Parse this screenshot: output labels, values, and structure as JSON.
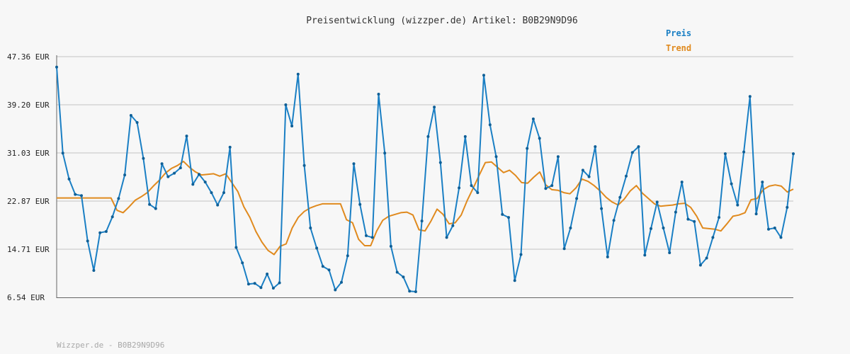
{
  "chart_data": {
    "type": "line",
    "title": "Preisentwicklung (wizzper.de) Artikel: B0B29N9D96",
    "footer": "Wizzper.de - B0B29N9D96",
    "y_tick_labels": [
      "47.36 EUR",
      "39.20 EUR",
      "31.03 EUR",
      "22.87 EUR",
      "14.71 EUR",
      "6.54 EUR"
    ],
    "y_ticks": [
      47.36,
      39.2,
      31.03,
      22.87,
      14.71,
      6.54
    ],
    "ylim": [
      6.54,
      47.36
    ],
    "grid": true,
    "legend_position": "top-right",
    "series": [
      {
        "name": "Preis",
        "color": "#1a7fc4",
        "values": [
          45.6,
          31.0,
          26.6,
          24.0,
          23.8,
          16.1,
          11.1,
          17.5,
          17.7,
          20.2,
          23.3,
          27.3,
          37.4,
          36.2,
          30.1,
          22.3,
          21.6,
          29.2,
          27.0,
          27.6,
          28.5,
          33.9,
          25.7,
          27.4,
          26.1,
          24.3,
          22.2,
          24.3,
          32.0,
          15.0,
          12.4,
          8.8,
          8.9,
          8.2,
          10.5,
          8.1,
          9.0,
          39.2,
          35.6,
          44.4,
          28.9,
          18.3,
          14.9,
          11.8,
          11.2,
          7.8,
          9.1,
          13.6,
          29.2,
          22.3,
          17.0,
          16.7,
          41.0,
          31.0,
          15.2,
          10.8,
          10.0,
          7.6,
          7.5,
          19.5,
          33.8,
          38.8,
          29.4,
          16.7,
          18.7,
          25.1,
          33.8,
          25.5,
          24.3,
          44.2,
          35.8,
          30.4,
          20.6,
          20.1,
          9.4,
          13.8,
          31.8,
          36.8,
          33.5,
          25.0,
          25.5,
          30.4,
          14.8,
          18.3,
          23.3,
          28.1,
          27.0,
          32.1,
          21.6,
          13.4,
          19.6,
          23.5,
          27.1,
          31.1,
          32.1,
          13.7,
          18.2,
          22.7,
          18.3,
          14.1,
          21.0,
          26.1,
          19.8,
          19.4,
          12.0,
          13.2,
          16.7,
          20.1,
          30.9,
          25.8,
          22.2,
          31.2,
          40.6,
          20.7,
          26.1,
          18.1,
          18.3,
          16.7,
          21.8,
          30.9
        ]
      },
      {
        "name": "Trend",
        "color": "#e08a1e",
        "values": [
          23.4,
          23.4,
          23.4,
          23.4,
          23.4,
          23.4,
          23.4,
          23.4,
          23.4,
          23.4,
          21.3,
          20.9,
          21.9,
          23.0,
          23.6,
          24.3,
          25.4,
          26.4,
          27.6,
          28.4,
          28.9,
          29.6,
          28.6,
          27.8,
          27.3,
          27.4,
          27.5,
          27.1,
          27.5,
          26.0,
          24.5,
          21.9,
          20.1,
          17.7,
          15.9,
          14.5,
          13.8,
          15.2,
          15.6,
          18.3,
          20.1,
          21.1,
          21.7,
          22.1,
          22.4,
          22.4,
          22.4,
          22.4,
          19.7,
          19.2,
          16.4,
          15.3,
          15.3,
          17.8,
          19.6,
          20.3,
          20.6,
          20.9,
          21.0,
          20.5,
          18.0,
          17.8,
          19.5,
          21.5,
          20.6,
          19.0,
          19.2,
          20.5,
          23.0,
          25.1,
          27.3,
          29.4,
          29.5,
          28.6,
          27.7,
          28.1,
          27.2,
          26.0,
          25.9,
          26.9,
          27.8,
          25.6,
          24.8,
          24.7,
          24.3,
          24.1,
          25.1,
          26.6,
          26.2,
          25.5,
          24.6,
          23.5,
          22.7,
          22.2,
          23.2,
          24.6,
          25.5,
          24.2,
          23.3,
          22.4,
          22.0,
          22.1,
          22.2,
          22.4,
          22.5,
          21.8,
          20.3,
          18.3,
          18.2,
          18.1,
          17.8,
          19.0,
          20.3,
          20.5,
          20.9,
          23.1,
          23.3,
          24.8,
          25.4,
          25.6,
          25.4,
          24.4,
          24.9
        ]
      }
    ]
  }
}
